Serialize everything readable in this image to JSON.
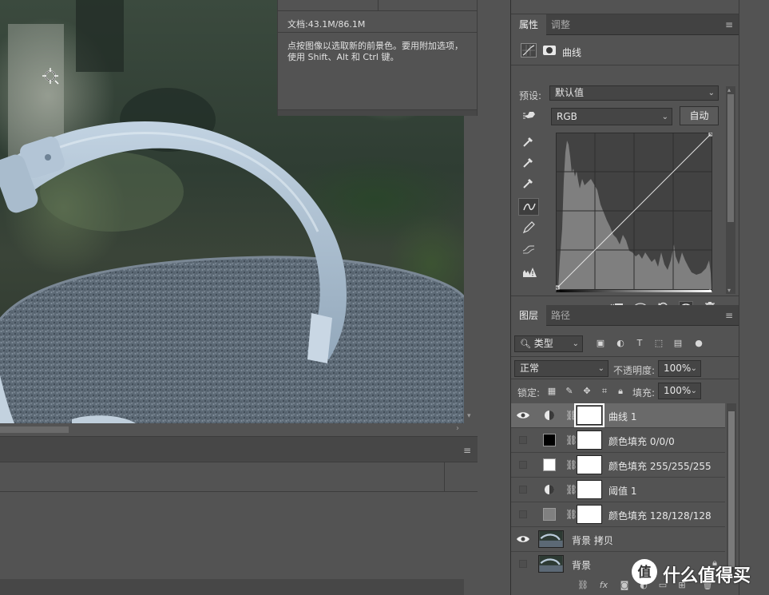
{
  "info_panel": {
    "doc_size": "文档:43.1M/86.1M",
    "hint": "点按图像以选取新的前景色。要用附加选项，使用 Shift、Alt 和 Ctrl 键。"
  },
  "properties": {
    "tabs": [
      {
        "label": "属性",
        "active": true
      },
      {
        "label": "调整",
        "active": false
      }
    ],
    "title": "曲线",
    "preset_label": "预设:",
    "preset_value": "默认值",
    "channel_value": "RGB",
    "auto_label": "自动",
    "tools": [
      "target-adjust-icon",
      "black-eyedropper-icon",
      "gray-eyedropper-icon",
      "white-eyedropper-icon",
      "curve-point-icon",
      "pencil-icon",
      "smooth-icon",
      "clipping-warning-icon"
    ],
    "footer_buttons": [
      "clip-to-layer-icon",
      "view-previous-icon",
      "reset-icon",
      "visibility-icon",
      "trash-icon"
    ]
  },
  "layers": {
    "tabs": [
      {
        "label": "图层",
        "active": true
      },
      {
        "label": "路径",
        "active": false
      }
    ],
    "filter_label": "类型",
    "blend_mode": "正常",
    "opacity_label": "不透明度:",
    "opacity_value": "100%",
    "lock_label": "锁定:",
    "fill_label": "填充:",
    "fill_value": "100%",
    "items": [
      {
        "name": "曲线 1",
        "visible": true,
        "kind": "adjustment",
        "selected": true
      },
      {
        "name": "颜色填充 0/0/0",
        "visible": false,
        "kind": "fill",
        "swatch": "#000000"
      },
      {
        "name": "颜色填充 255/255/255",
        "visible": false,
        "kind": "fill",
        "swatch": "#ffffff"
      },
      {
        "name": "阈值 1",
        "visible": false,
        "kind": "adjustment"
      },
      {
        "name": "颜色填充 128/128/128",
        "visible": false,
        "kind": "fill",
        "swatch": "#808080"
      },
      {
        "name": "背景 拷贝",
        "visible": true,
        "kind": "photo"
      },
      {
        "name": "背景",
        "visible": false,
        "kind": "photo",
        "locked": true
      }
    ],
    "footer_buttons": [
      "link-icon",
      "fx-icon",
      "mask-icon",
      "adjustment-icon",
      "group-icon",
      "new-layer-icon",
      "trash-icon"
    ]
  },
  "watermark": {
    "logo_glyph": "值",
    "text": "什么值得买"
  }
}
